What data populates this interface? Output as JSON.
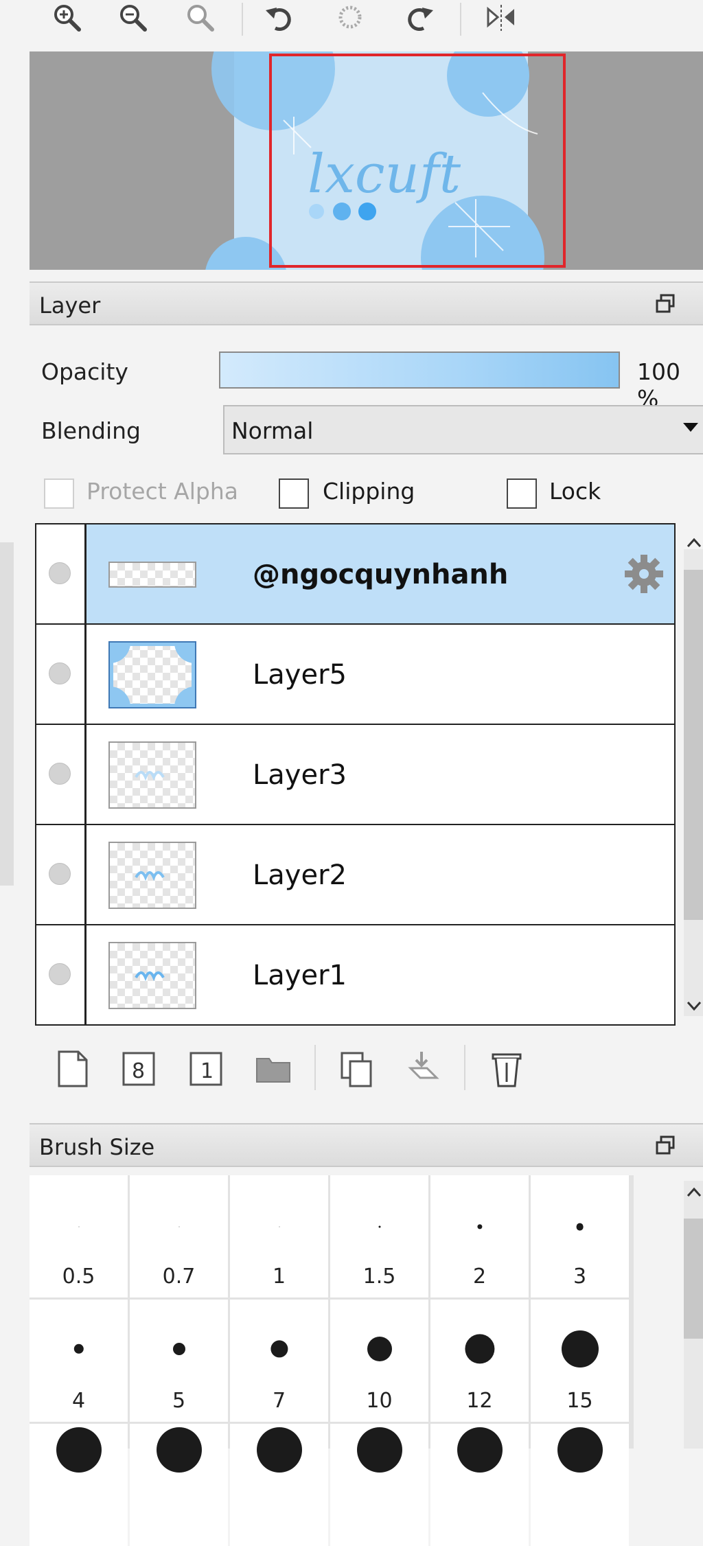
{
  "toolbar": {
    "buttons": [
      "zoom-in",
      "zoom-out",
      "zoom-reset",
      "rotate-left",
      "rotate-reset",
      "rotate-right",
      "flip-horizontal"
    ]
  },
  "navigator": {
    "preview_text": "lxcuft"
  },
  "layer_panel": {
    "title": "Layer",
    "opacity_label": "Opacity",
    "opacity_value": 1.0,
    "opacity_text": "100 %",
    "blending_label": "Blending",
    "blending_value": "Normal",
    "protect_alpha_label": "Protect Alpha",
    "clipping_label": "Clipping",
    "lock_label": "Lock",
    "layers": [
      {
        "name": "@ngocquynhanh",
        "selected": true
      },
      {
        "name": "Layer5",
        "selected": false
      },
      {
        "name": "Layer3",
        "selected": false
      },
      {
        "name": "Layer2",
        "selected": false
      },
      {
        "name": "Layer1",
        "selected": false
      }
    ]
  },
  "brush_panel": {
    "title": "Brush Size",
    "sizes": [
      "0.5",
      "0.7",
      "1",
      "1.5",
      "2",
      "3",
      "4",
      "5",
      "7",
      "10",
      "12",
      "15"
    ]
  },
  "colors": {
    "selection_bg": "#bfdff8",
    "accent_blue": "#86c4f1",
    "navigator_frame": "#e0262b"
  }
}
